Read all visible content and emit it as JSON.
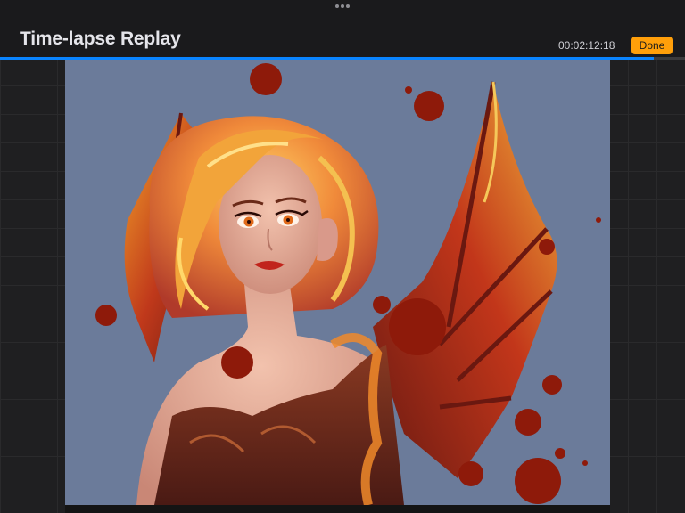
{
  "header": {
    "title": "Time-lapse Replay",
    "timestamp": "00:02:12:18",
    "done_label": "Done"
  },
  "playback": {
    "progress": 0.955
  },
  "colors": {
    "accent": "#ff9f0a",
    "progress": "#0a84ff",
    "canvas_background": "#6b7b9a"
  },
  "icons": {
    "grabber": "more-dots-icon"
  }
}
